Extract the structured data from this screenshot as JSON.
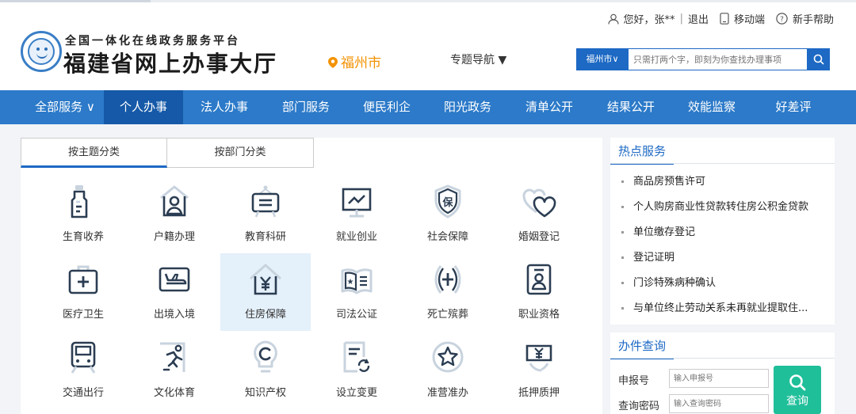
{
  "header": {
    "site_subtitle": "全国一体化在线政务服务平台",
    "site_title": "福建省网上办事大厅",
    "city": "福州市",
    "topic_nav": "专题导航 ▼",
    "user_greeting": "您好，张**",
    "logout": "退出",
    "mobile": "移动端",
    "help": "新手帮助",
    "search_city": "福州市∨",
    "search_placeholder": "只需打两个字，即刻为你查找办理事项"
  },
  "nav": {
    "items": [
      "全部服务 ∨",
      "个人办事",
      "法人办事",
      "部门服务",
      "便民利企",
      "阳光政务",
      "清单公开",
      "结果公开",
      "效能监察",
      "好差评"
    ],
    "active_index": 1
  },
  "category_tabs": [
    "按主题分类",
    "按部门分类"
  ],
  "categories": [
    {
      "label": "生育收养",
      "icon": "baby-bottle-icon"
    },
    {
      "label": "户籍办理",
      "icon": "household-person-icon"
    },
    {
      "label": "教育科研",
      "icon": "blackboard-icon"
    },
    {
      "label": "就业创业",
      "icon": "monitor-trend-icon"
    },
    {
      "label": "社会保障",
      "icon": "shield-bao-icon"
    },
    {
      "label": "婚姻登记",
      "icon": "hearts-icon"
    },
    {
      "label": "医疗卫生",
      "icon": "medical-kit-icon"
    },
    {
      "label": "出境入境",
      "icon": "airplane-icon"
    },
    {
      "label": "住房保障",
      "icon": "house-yuan-icon"
    },
    {
      "label": "司法公证",
      "icon": "law-book-icon"
    },
    {
      "label": "死亡殡葬",
      "icon": "funeral-cross-icon"
    },
    {
      "label": "职业资格",
      "icon": "badge-person-icon"
    },
    {
      "label": "交通出行",
      "icon": "train-icon"
    },
    {
      "label": "文化体育",
      "icon": "runner-icon"
    },
    {
      "label": "知识产权",
      "icon": "copyright-bulb-icon"
    },
    {
      "label": "设立变更",
      "icon": "document-refresh-icon"
    },
    {
      "label": "准营准办",
      "icon": "star-badge-icon"
    },
    {
      "label": "抵押质押",
      "icon": "yuan-tag-icon"
    }
  ],
  "highlighted_category": "住房保障",
  "hot_services": {
    "title": "热点服务",
    "items": [
      "商品房预售许可",
      "个人购房商业性贷款转住房公积金贷款",
      "单位缴存登记",
      "登记证明",
      "门诊特殊病种确认",
      "与单位终止劳动关系未再就业提取住..."
    ]
  },
  "query": {
    "title": "办件查询",
    "number_label": "申报号",
    "number_placeholder": "输入申报号",
    "password_label": "查询密码",
    "password_placeholder": "输入查询密码",
    "button": "查询"
  },
  "colors": {
    "nav_blue": "#2c7ac9",
    "nav_active": "#1559a8",
    "accent_blue": "#1d69c4",
    "city_orange": "#f39200",
    "query_green": "#1fbf9a",
    "highlight_bg": "#e4f0fa"
  }
}
